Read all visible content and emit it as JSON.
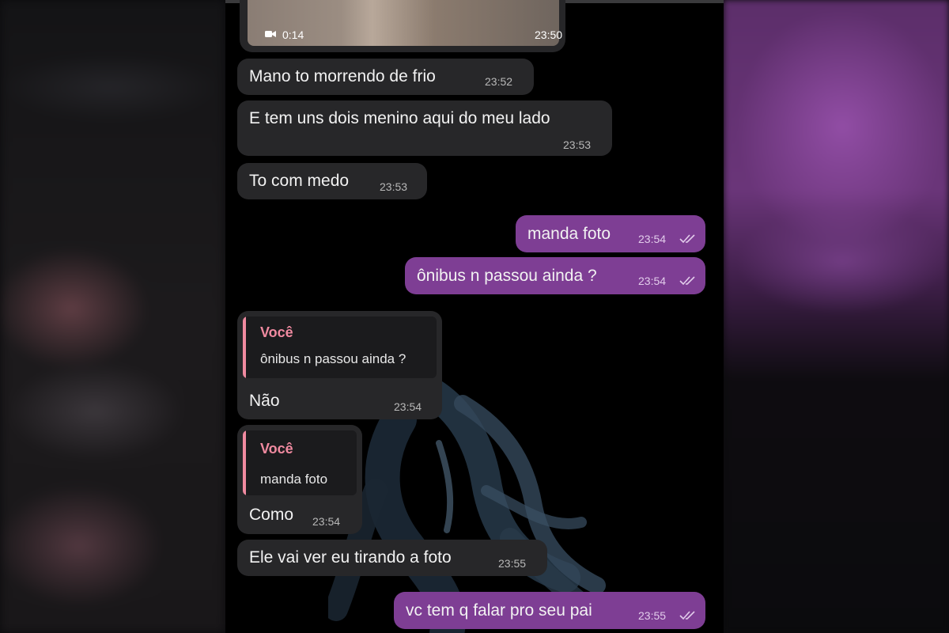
{
  "video": {
    "duration": "0:14",
    "time": "23:50",
    "icon": "video-camera-icon"
  },
  "messages": [
    {
      "direction": "in",
      "text": "Mano to morrendo de frio",
      "time": "23:52"
    },
    {
      "direction": "in",
      "text": "E tem uns dois menino aqui do meu lado",
      "time": "23:53"
    },
    {
      "direction": "in",
      "text": "To com medo",
      "time": "23:53"
    },
    {
      "direction": "out",
      "text": "manda foto",
      "time": "23:54",
      "status": "read-ticks-icon"
    },
    {
      "direction": "out",
      "text": "ônibus n passou ainda ?",
      "time": "23:54",
      "status": "read-ticks-icon"
    },
    {
      "direction": "in",
      "quote_author": "Você",
      "quote_text": "ônibus n passou ainda ?",
      "text": "Não",
      "time": "23:54"
    },
    {
      "direction": "in",
      "quote_author": "Você",
      "quote_text": "manda foto",
      "text": "Como",
      "time": "23:54"
    },
    {
      "direction": "in",
      "text": "Ele vai ver eu tirando a foto",
      "time": "23:55"
    },
    {
      "direction": "out",
      "text": "vc tem q falar pro seu pai",
      "time": "23:55",
      "status": "read-ticks-icon"
    }
  ],
  "colors": {
    "incoming_bubble": "#272729",
    "outgoing_bubble": "#7e3e94",
    "quote_accent": "#f08aa0",
    "background": "#000000"
  }
}
